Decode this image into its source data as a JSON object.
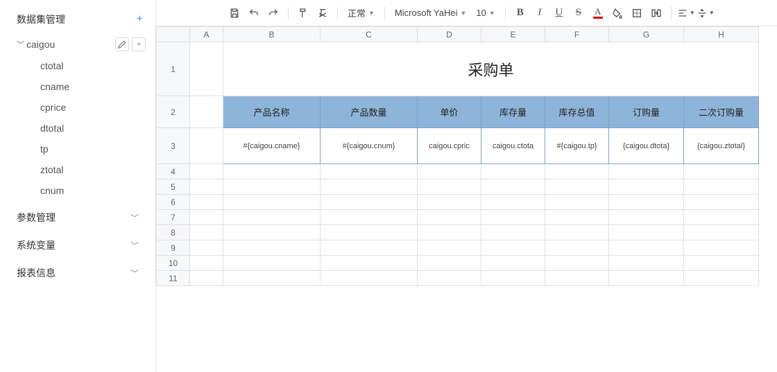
{
  "sidebar": {
    "dataset_mgmt": "数据集管理",
    "tree": {
      "root": "caigou",
      "fields": [
        "ctotal",
        "cname",
        "cprice",
        "dtotal",
        "tp",
        "ztotal",
        "cnum"
      ]
    },
    "sections": [
      "参数管理",
      "系统变量",
      "报表信息"
    ]
  },
  "toolbar": {
    "format_mode": "正常",
    "font_family": "Microsoft YaHei",
    "font_size": "10"
  },
  "sheet": {
    "columns": [
      "A",
      "B",
      "C",
      "D",
      "E",
      "F",
      "G",
      "H"
    ],
    "row_count": 11,
    "title": "采购单",
    "headers": [
      "产品名称",
      "产品数量",
      "单价",
      "库存量",
      "库存总值",
      "订购量",
      "二次订购量"
    ],
    "data_row": [
      "#{caigou.cname}",
      "#{caigou.cnum}",
      "caigou.cpric",
      "caigou.ctota",
      "#{caigou.tp}",
      "{caigou.dtota}",
      "{caigou.ztotal}"
    ]
  }
}
